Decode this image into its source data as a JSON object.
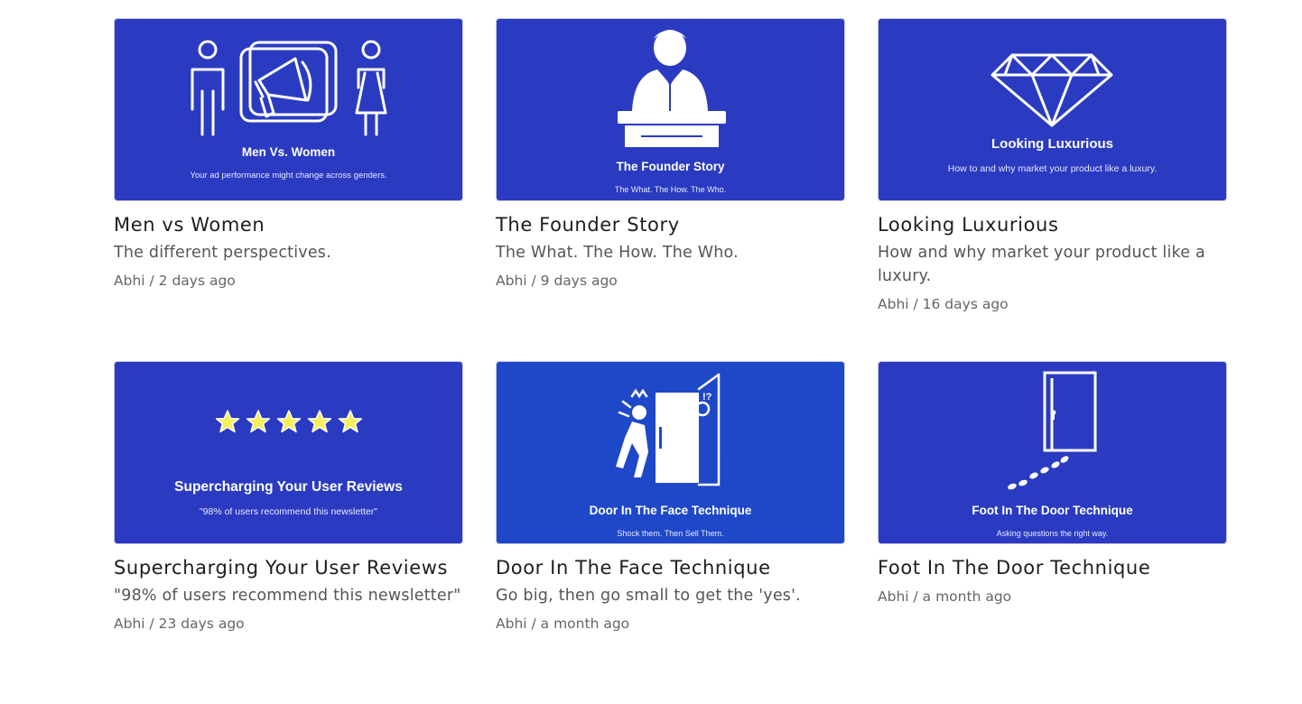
{
  "colors": {
    "thumb_bg": "#2b3bc1",
    "thumb_bg_bright": "#1f48c9",
    "star": "#f6ef5a"
  },
  "posts": [
    {
      "thumb_title": "Men Vs. Women",
      "thumb_sub": "Your ad performance might change across genders.",
      "title": "Men vs Women",
      "desc": "The different perspectives.",
      "author": "Abhi",
      "sep": " / ",
      "time": "2 days ago",
      "icon": "megaphone-icon"
    },
    {
      "thumb_title": "The Founder Story",
      "thumb_sub": "The What. The How. The Who.",
      "title": "The Founder Story",
      "desc": "The What. The How. The Who.",
      "author": "Abhi",
      "sep": " / ",
      "time": "9 days ago",
      "icon": "speaker-podium-icon"
    },
    {
      "thumb_title": "Looking Luxurious",
      "thumb_sub": "How to and why market your product like a luxury.",
      "title": "Looking Luxurious",
      "desc": "How and why market your product like a luxury.",
      "author": "Abhi",
      "sep": " / ",
      "time": "16 days ago",
      "icon": "diamond-icon"
    },
    {
      "thumb_title": "Supercharging Your User Reviews",
      "thumb_sub": "\"98% of users recommend this newsletter\"",
      "title": "Supercharging Your User Reviews",
      "desc": "\"98% of users recommend this newsletter\"",
      "author": "Abhi",
      "sep": " / ",
      "time": "23 days ago",
      "icon": "five-stars-icon"
    },
    {
      "thumb_title": "Door In The Face Technique",
      "thumb_sub": "Shock them. Then Sell Them.",
      "title": "Door In The Face Technique",
      "desc": "Go big, then go small to get the 'yes'.",
      "author": "Abhi",
      "sep": " / ",
      "time": "a month ago",
      "icon": "door-slam-icon"
    },
    {
      "thumb_title": "Foot In The Door Technique",
      "thumb_sub": "Asking questions the right way.",
      "title": "Foot In The Door Technique",
      "desc": "",
      "author": "Abhi",
      "sep": " / ",
      "time": "a month ago",
      "icon": "door-footsteps-icon"
    }
  ]
}
